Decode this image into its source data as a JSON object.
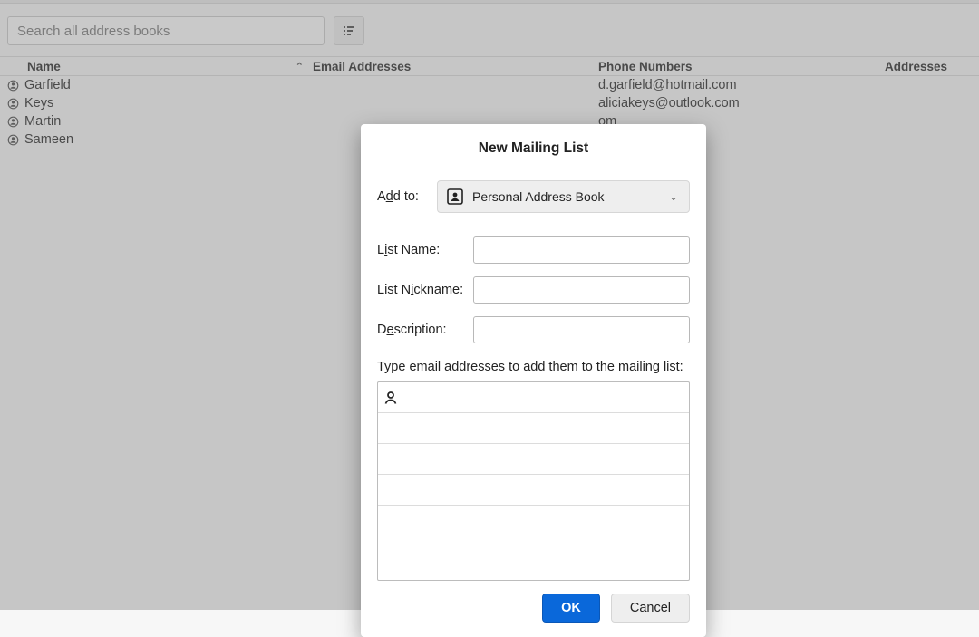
{
  "toolbar": {
    "search_placeholder": "Search all address books"
  },
  "columns": {
    "name": "Name",
    "email": "Email Addresses",
    "phone": "Phone Numbers",
    "address": "Addresses",
    "sort_indicator": "⌃"
  },
  "rows": [
    {
      "name": "Garfield",
      "email": "",
      "phone": "d.garfield@hotmail.com",
      "address": ""
    },
    {
      "name": "Keys",
      "email": "",
      "phone": "aliciakeys@outlook.com",
      "address": ""
    },
    {
      "name": "Martin",
      "email": "",
      "phone": "om",
      "address": ""
    },
    {
      "name": "Sameen",
      "email": "",
      "phone": "",
      "address": ""
    }
  ],
  "dialog": {
    "title": "New Mailing List",
    "add_to_pre": "A",
    "add_to_u": "d",
    "add_to_post": "d to:",
    "add_to_value": "Personal Address Book",
    "list_name_pre": "L",
    "list_name_u": "i",
    "list_name_post": "st Name:",
    "nickname_pre": "List N",
    "nickname_u": "i",
    "nickname_post": "ckname:",
    "description_pre": "D",
    "description_u": "e",
    "description_post": "scription:",
    "instruction_pre": "Type em",
    "instruction_u": "a",
    "instruction_post": "il addresses to add them to the mailing list:",
    "ok": "OK",
    "cancel": "Cancel",
    "list_name_value": "",
    "nickname_value": "",
    "description_value": ""
  }
}
